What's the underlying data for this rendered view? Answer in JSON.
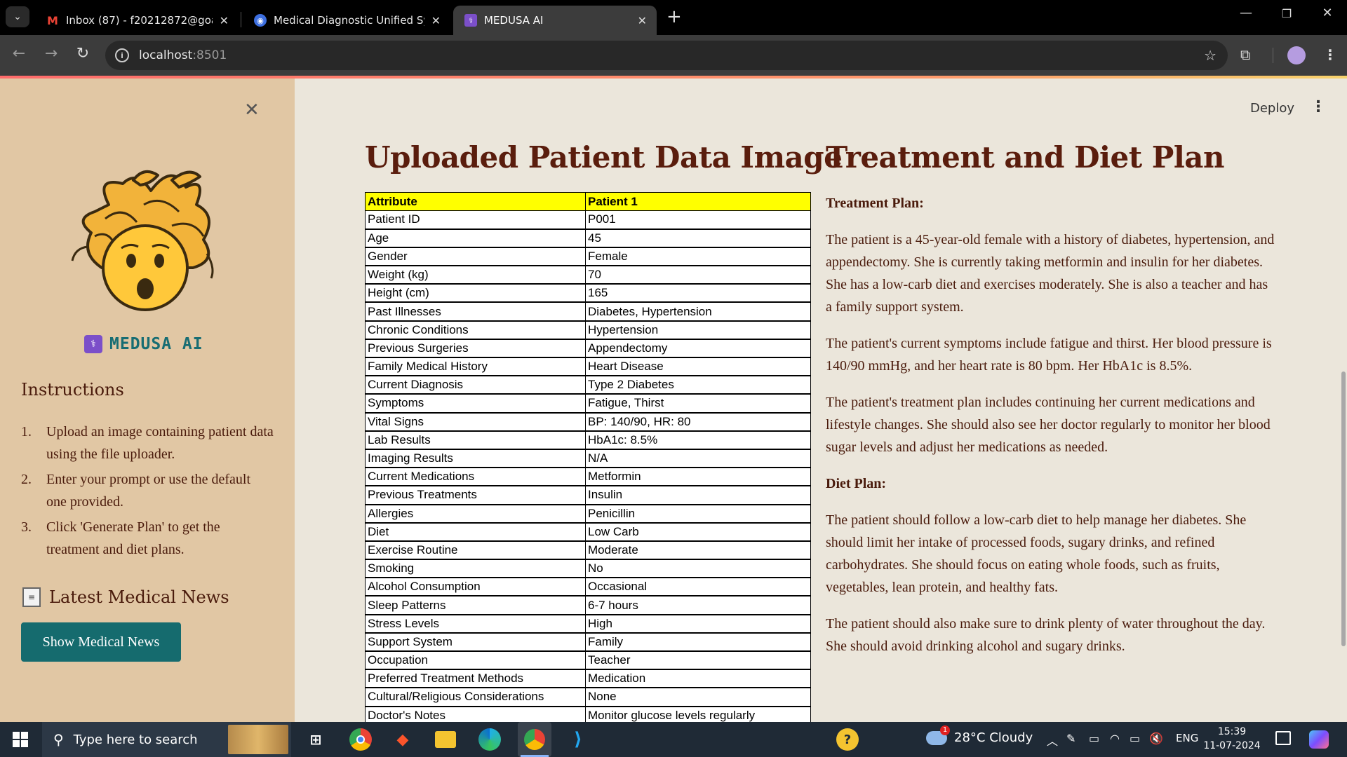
{
  "browser": {
    "tabs": [
      {
        "title": "Inbox (87) - f20212872@goa.bits",
        "icon": "gmail-icon",
        "active": false
      },
      {
        "title": "Medical Diagnostic Unified Syst",
        "icon": "medical-app-icon",
        "active": false
      },
      {
        "title": "MEDUSA AI",
        "icon": "medusa-favicon",
        "active": true
      }
    ],
    "tab_close": "✕",
    "new_tab": "+",
    "url_host": "localhost",
    "url_port": ":8501"
  },
  "sidebar": {
    "brand": "MEDUSA AI",
    "instructions_heading": "Instructions",
    "instructions": [
      {
        "num": "1.",
        "text": "Upload an image containing patient data using the file uploader."
      },
      {
        "num": "2.",
        "text": "Enter your prompt or use the default one provided."
      },
      {
        "num": "3.",
        "text": "Click 'Generate Plan' to get the treatment and diet plans."
      }
    ],
    "news_heading": "Latest Medical News",
    "news_button": "Show Medical News"
  },
  "header": {
    "deploy": "Deploy",
    "menu": "⋮"
  },
  "left_column": {
    "title": "Uploaded Patient Data Image",
    "table": {
      "headers": [
        "Attribute",
        "Patient 1"
      ],
      "rows": [
        [
          "Patient ID",
          "P001"
        ],
        [
          "Age",
          "45"
        ],
        [
          "Gender",
          "Female"
        ],
        [
          "Weight (kg)",
          "70"
        ],
        [
          "Height (cm)",
          "165"
        ],
        [
          "Past Illnesses",
          "Diabetes, Hypertension"
        ],
        [
          "Chronic Conditions",
          "Hypertension"
        ],
        [
          "Previous Surgeries",
          "Appendectomy"
        ],
        [
          "Family Medical History",
          "Heart Disease"
        ],
        [
          "Current Diagnosis",
          "Type 2 Diabetes"
        ],
        [
          "Symptoms",
          "Fatigue, Thirst"
        ],
        [
          "Vital Signs",
          "BP: 140/90, HR: 80"
        ],
        [
          "Lab Results",
          "HbA1c: 8.5%"
        ],
        [
          "Imaging Results",
          "N/A"
        ],
        [
          "Current Medications",
          "Metformin"
        ],
        [
          "Previous Treatments",
          "Insulin"
        ],
        [
          "Allergies",
          "Penicillin"
        ],
        [
          "Diet",
          "Low Carb"
        ],
        [
          "Exercise Routine",
          "Moderate"
        ],
        [
          "Smoking",
          "No"
        ],
        [
          "Alcohol Consumption",
          "Occasional"
        ],
        [
          "Sleep Patterns",
          "6-7 hours"
        ],
        [
          "Stress Levels",
          "High"
        ],
        [
          "Support System",
          "Family"
        ],
        [
          "Occupation",
          "Teacher"
        ],
        [
          "Preferred Treatment Methods",
          "Medication"
        ],
        [
          "Cultural/Religious Considerations",
          "None"
        ],
        [
          "Doctor's Notes",
          "Monitor glucose levels regularly"
        ]
      ]
    }
  },
  "right_column": {
    "title": "Treatment and Diet Plan",
    "treatment_heading": "Treatment Plan:",
    "treatment_paragraphs": [
      "The patient is a 45-year-old female with a history of diabetes, hypertension, and appendectomy. She is currently taking metformin and insulin for her diabetes. She has a low-carb diet and exercises moderately. She is also a teacher and has a family support system.",
      "The patient's current symptoms include fatigue and thirst. Her blood pressure is 140/90 mmHg, and her heart rate is 80 bpm. Her HbA1c is 8.5%.",
      "The patient's treatment plan includes continuing her current medications and lifestyle changes. She should also see her doctor regularly to monitor her blood sugar levels and adjust her medications as needed."
    ],
    "diet_heading": "Diet Plan:",
    "diet_paragraphs": [
      "The patient should follow a low-carb diet to help manage her diabetes. She should limit her intake of processed foods, sugary drinks, and refined carbohydrates. She should focus on eating whole foods, such as fruits, vegetables, lean protein, and healthy fats.",
      "The patient should also make sure to drink plenty of water throughout the day. She should avoid drinking alcohol and sugary drinks."
    ]
  },
  "taskbar": {
    "search_placeholder": "Type here to search",
    "weather": "28°C  Cloudy",
    "weather_badge": "1",
    "language": "ENG",
    "time": "15:39",
    "date": "11-07-2024"
  }
}
